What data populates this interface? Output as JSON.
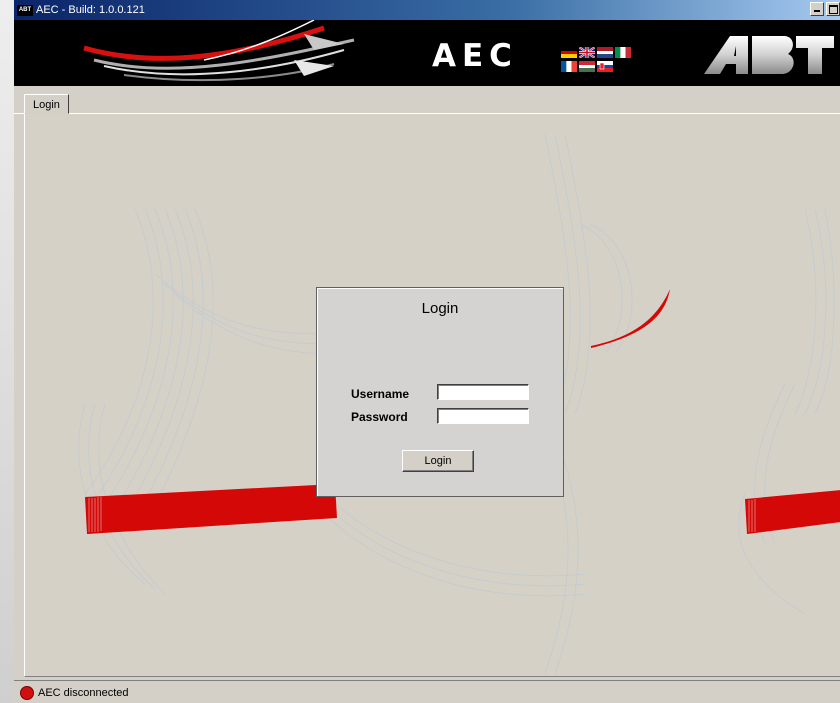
{
  "window": {
    "title": "AEC - Build: 1.0.0.121",
    "icon_label": "ABT"
  },
  "banner": {
    "title": "AEC",
    "logo": "ABT",
    "flags": [
      "german-flag",
      "uk-flag",
      "dutch-flag",
      "italian-flag",
      "french-flag",
      "hungarian-flag",
      "slovak-flag"
    ]
  },
  "tabs": [
    {
      "label": "Login",
      "active": true
    }
  ],
  "login_dialog": {
    "title": "Login",
    "username_label": "Username",
    "username_value": "",
    "password_label": "Password",
    "password_value": "",
    "button_label": "Login"
  },
  "status": {
    "text": "AEC disconnected",
    "color": "#d01010"
  },
  "colors": {
    "title_bar_start": "#0a246a",
    "title_bar_end": "#a6caf0",
    "accent_red": "#d81010"
  }
}
